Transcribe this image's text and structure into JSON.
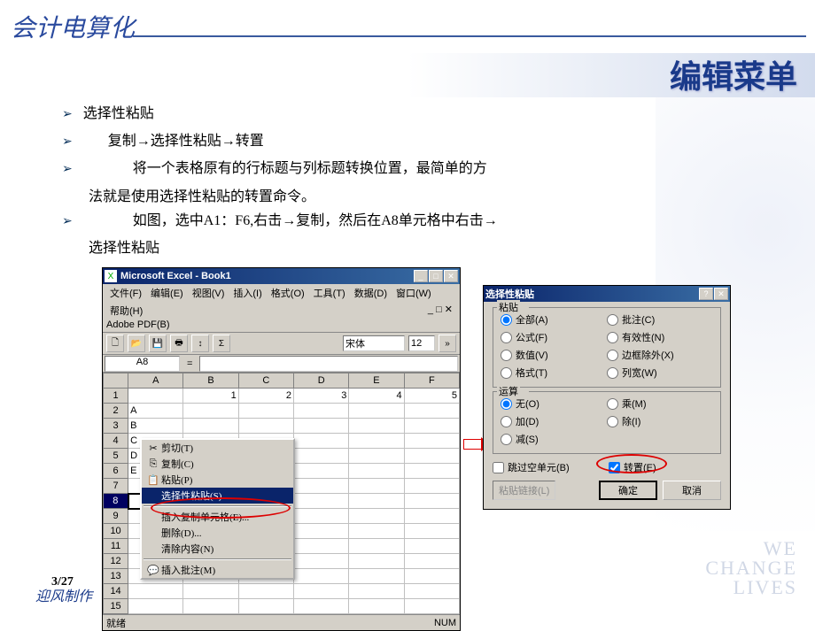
{
  "slide": {
    "title_left": "会计电算化",
    "title_right": "编辑菜单",
    "page_num": "3/27",
    "footer": "迎风制作",
    "deco1": "WE",
    "deco2": "CHANGE",
    "deco3": "LIVES"
  },
  "bullets": {
    "b1": "选择性粘贴",
    "b2": "复制→选择性粘贴→转置",
    "b3": "将一个表格原有的行标题与列标题转换位置，最简单的方",
    "b3c": "法就是使用选择性粘贴的转置命令。",
    "b4": "如图，选中A1：F6,右击→复制，然后在A8单元格中右击→",
    "b4c": "选择性粘贴"
  },
  "excel": {
    "title": "Microsoft Excel - Book1",
    "menu": {
      "file": "文件(F)",
      "edit": "编辑(E)",
      "view": "视图(V)",
      "insert": "插入(I)",
      "format": "格式(O)",
      "tools": "工具(T)",
      "data": "数据(D)",
      "window": "窗口(W)",
      "help": "帮助(H)"
    },
    "menu2": "Adobe PDF(B)",
    "font": "宋体",
    "fontsize": "12",
    "namebox": "A8",
    "cols": [
      "A",
      "B",
      "C",
      "D",
      "E",
      "F"
    ],
    "rows": [
      "1",
      "2",
      "3",
      "4",
      "5",
      "6",
      "7",
      "8",
      "9",
      "10",
      "11",
      "12",
      "13",
      "14",
      "15"
    ],
    "data_row1": {
      "b": "1",
      "c": "2",
      "d": "3",
      "e": "4",
      "f": "5"
    },
    "colA": {
      "r2": "A",
      "r3": "B",
      "r4": "C",
      "r5": "D",
      "r6": "E"
    },
    "status_ready": "就绪",
    "status_num": "NUM"
  },
  "ctx": {
    "cut": "剪切(T)",
    "copy": "复制(C)",
    "paste": "粘贴(P)",
    "pastespecial": "选择性粘贴(S)...",
    "insertcells": "插入复制单元格(E)...",
    "delete": "删除(D)...",
    "clear": "清除内容(N)",
    "insertcomment": "插入批注(M)"
  },
  "dialog": {
    "title": "选择性粘贴",
    "group_paste": "粘贴",
    "all": "全部(A)",
    "formulas": "公式(F)",
    "values": "数值(V)",
    "formats": "格式(T)",
    "comments": "批注(C)",
    "validation": "有效性(N)",
    "borders": "边框除外(X)",
    "colwidth": "列宽(W)",
    "group_op": "运算",
    "none": "无(O)",
    "add": "加(D)",
    "sub": "减(S)",
    "mul": "乘(M)",
    "div": "除(I)",
    "skip": "跳过空单元(B)",
    "transpose": "转置(E)",
    "pastelink": "粘贴链接(L)",
    "ok": "确定",
    "cancel": "取消"
  }
}
